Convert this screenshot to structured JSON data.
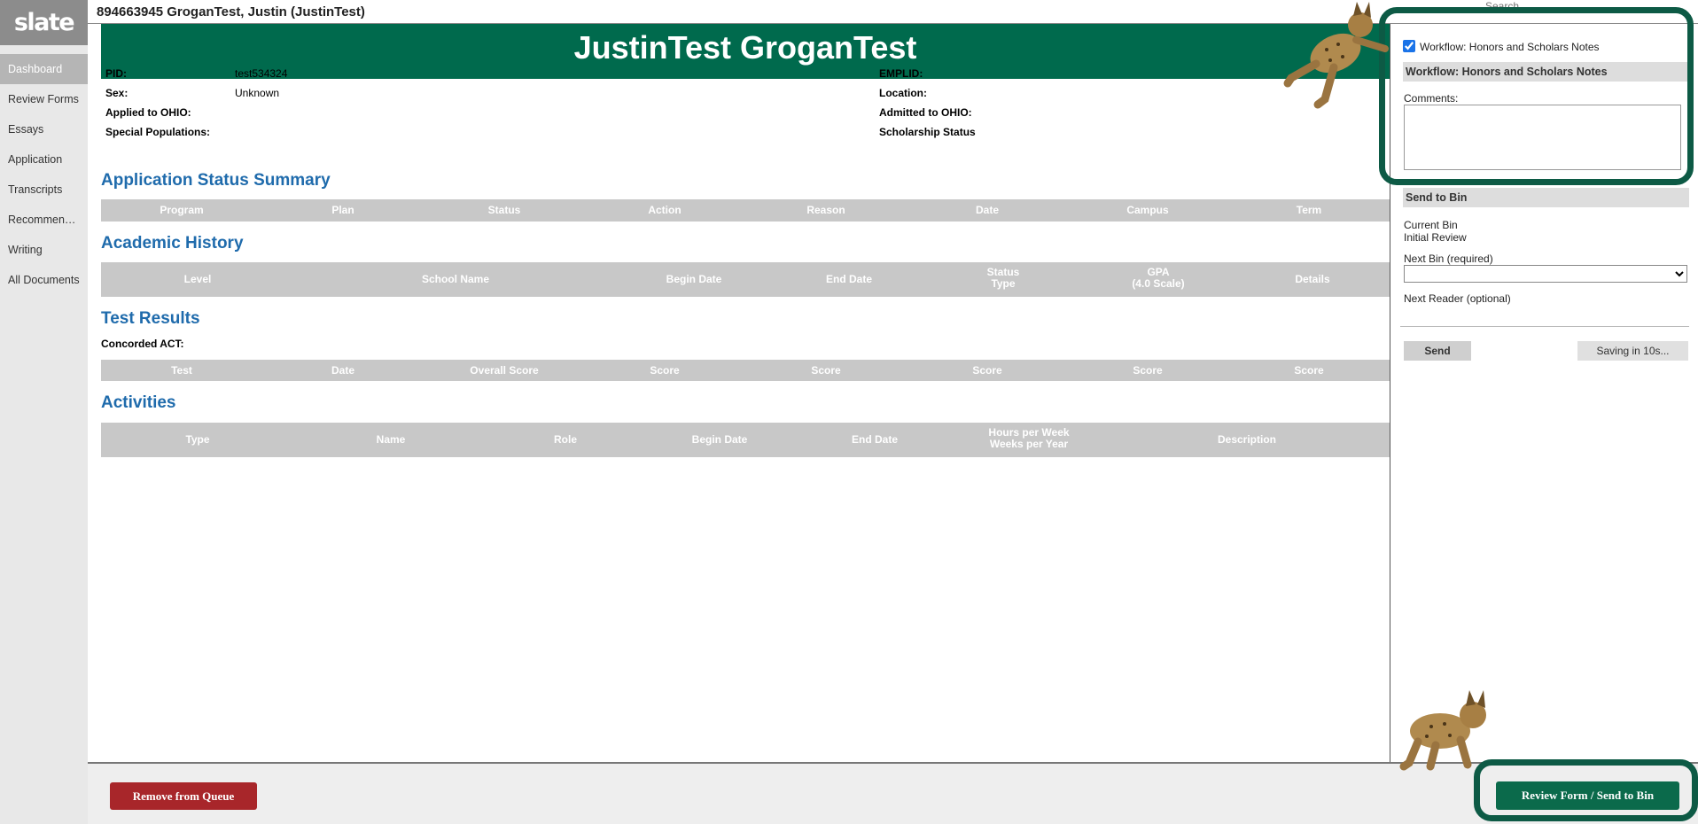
{
  "nav": {
    "logo": "slate",
    "items": [
      {
        "label": "Dashboard",
        "active": true
      },
      {
        "label": "Review Forms"
      },
      {
        "label": "Essays"
      },
      {
        "label": "Application"
      },
      {
        "label": "Transcripts"
      },
      {
        "label": "Recommendati..."
      },
      {
        "label": "Writing"
      },
      {
        "label": "All Documents"
      }
    ]
  },
  "header": {
    "title": "894663945 GroganTest, Justin (JustinTest)"
  },
  "search": {
    "placeholder": "Search..."
  },
  "banner": {
    "name": "JustinTest GroganTest"
  },
  "fields": {
    "pid_label": "PID:",
    "pid_value": "test534324",
    "sex_label": "Sex:",
    "sex_value": "Unknown",
    "applied_label": "Applied to OHIO:",
    "special_label": "Special Populations:",
    "emplid_label": "EMPLID:",
    "location_label": "Location:",
    "admitted_label": "Admitted to OHIO:",
    "scholarship_label": "Scholarship Status"
  },
  "sections": {
    "app_status": {
      "title": "Application Status Summary",
      "columns": [
        "Program",
        "Plan",
        "Status",
        "Action",
        "Reason",
        "Date",
        "Campus",
        "Term"
      ]
    },
    "academic": {
      "title": "Academic History",
      "columns": [
        "Level",
        "School Name",
        "Begin Date",
        "End Date",
        "Status Type",
        "GPA (4.0 Scale)",
        "Details"
      ],
      "status_type": [
        "Status",
        "Type"
      ],
      "gpa": [
        "GPA",
        "(4.0 Scale)"
      ]
    },
    "tests": {
      "title": "Test Results",
      "concorded_label": "Concorded ACT:",
      "columns": [
        "Test",
        "Date",
        "Overall Score",
        "Score",
        "Score",
        "Score",
        "Score",
        "Score"
      ]
    },
    "activities": {
      "title": "Activities",
      "columns": [
        "Type",
        "Name",
        "Role",
        "Begin Date",
        "End Date",
        "Hours per Week Weeks per Year",
        "Description"
      ],
      "hours": [
        "Hours per Week",
        "Weeks per Year"
      ]
    }
  },
  "right_panel": {
    "workflow_checkbox_label": "Workflow: Honors and Scholars Notes",
    "workflow_checked": true,
    "workflow_header": "Workflow: Honors and Scholars Notes",
    "comments_label": "Comments:",
    "send_to_bin_header": "Send to Bin",
    "current_bin_label": "Current Bin",
    "current_bin_value": "Initial Review",
    "next_bin_label": "Next Bin (required)",
    "next_reader_label": "Next Reader (optional)",
    "send_label": "Send",
    "saving_label": "Saving in 10s..."
  },
  "footer": {
    "remove_label": "Remove from Queue",
    "review_label": "Review Form / Send to Bin"
  },
  "colors": {
    "brand_green": "#006a4d",
    "link_blue": "#1f6bac",
    "remove_red": "#a8262a",
    "highlight": "#0d5a45"
  }
}
